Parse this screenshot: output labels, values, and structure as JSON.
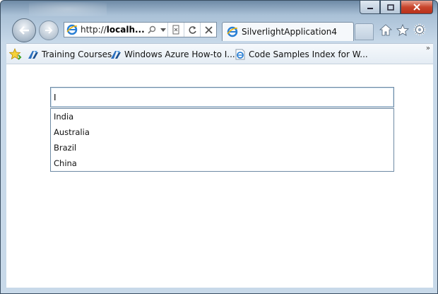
{
  "browser": {
    "address_url_prefix": "http://",
    "address_url_host": "localh...",
    "tab_title": "SilverlightApplication4"
  },
  "favorites": {
    "items": [
      {
        "label": "Training Courses",
        "icon": "azure-icon"
      },
      {
        "label": "Windows Azure How-to I...",
        "icon": "azure-icon"
      },
      {
        "label": "Code Samples Index for W...",
        "icon": "ie-page-icon"
      }
    ],
    "overflow": "»"
  },
  "autocomplete": {
    "input_value": "I",
    "suggestions": [
      "India",
      "Australia",
      "Brazil",
      "China"
    ]
  },
  "colors": {
    "accent": "#6e8aa4",
    "close": "#c8452c"
  }
}
